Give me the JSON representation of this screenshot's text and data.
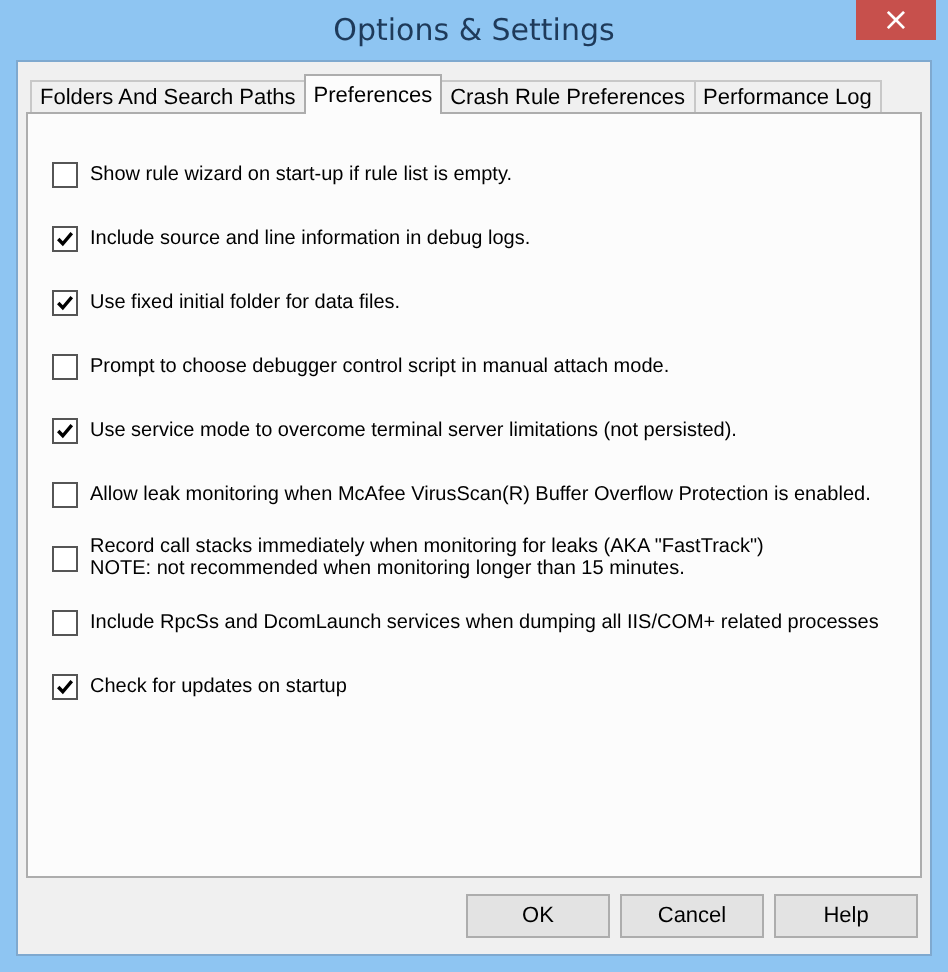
{
  "window": {
    "title": "Options & Settings",
    "close": "×"
  },
  "tabs": [
    {
      "label": "Folders And Search Paths",
      "selected": false
    },
    {
      "label": "Preferences",
      "selected": true
    },
    {
      "label": "Crash Rule Preferences",
      "selected": false
    },
    {
      "label": "Performance Log",
      "selected": false
    }
  ],
  "options": [
    {
      "lines": [
        "Show rule wizard on start-up if rule list is empty."
      ],
      "checked": false
    },
    {
      "lines": [
        "Include source and line information in debug logs."
      ],
      "checked": true
    },
    {
      "lines": [
        "Use fixed initial folder for data files."
      ],
      "checked": true
    },
    {
      "lines": [
        "Prompt to choose debugger control script in manual attach mode."
      ],
      "checked": false
    },
    {
      "lines": [
        "Use service mode to overcome terminal server limitations (not persisted)."
      ],
      "checked": true
    },
    {
      "lines": [
        "Allow leak monitoring when McAfee VirusScan(R) Buffer Overflow Protection is enabled."
      ],
      "checked": false
    },
    {
      "lines": [
        "Record call stacks immediately when monitoring for leaks (AKA \"FastTrack\")",
        "NOTE:  not recommended when monitoring longer than 15 minutes."
      ],
      "checked": false
    },
    {
      "lines": [
        "Include RpcSs and DcomLaunch services when dumping all IIS/COM+ related processes"
      ],
      "checked": false
    },
    {
      "lines": [
        "Check for updates on startup"
      ],
      "checked": true
    }
  ],
  "buttons": [
    "OK",
    "Cancel",
    "Help"
  ]
}
